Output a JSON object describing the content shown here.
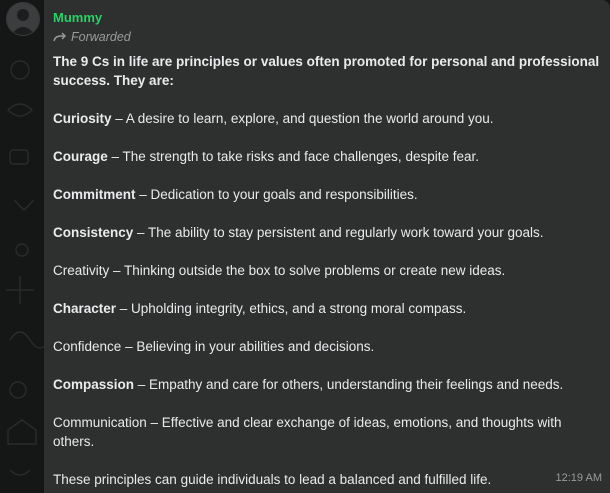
{
  "message": {
    "sender": "Mummy",
    "forwarded_label": "Forwarded",
    "intro": "The 9 Cs in life are principles or values often promoted for personal and professional success. They are:",
    "items": [
      {
        "term": "Curiosity",
        "desc": " – A desire to learn, explore, and question the world around you.",
        "bold": true
      },
      {
        "term": "Courage",
        "desc": " – The strength to take risks and face challenges, despite fear.",
        "bold": true
      },
      {
        "term": "Commitment",
        "desc": " – Dedication to your goals and responsibilities.",
        "bold": true
      },
      {
        "term": "Consistency",
        "desc": " – The ability to stay persistent and regularly work toward your goals.",
        "bold": true
      },
      {
        "term": "Creativity",
        "desc": " – Thinking outside the box to solve problems or create new ideas.",
        "bold": false
      },
      {
        "term": "Character",
        "desc": " – Upholding integrity, ethics, and a strong moral compass.",
        "bold": true
      },
      {
        "term": "Confidence",
        "desc": " – Believing in your abilities and decisions.",
        "bold": false
      },
      {
        "term": "Compassion",
        "desc": " – Empathy and care for others, understanding their feelings and needs.",
        "bold": true
      },
      {
        "term": "Communication",
        "desc": " – Effective and clear exchange of ideas, emotions, and thoughts with others.",
        "bold": false
      }
    ],
    "closing": "These principles can guide individuals to lead a balanced and fulfilled life.",
    "time": "12:19 AM"
  },
  "colors": {
    "sender": "#25d366",
    "bubble": "#2e2f2f",
    "background": "#151616",
    "text": "#e9ebec",
    "meta": "#9a9b9c"
  },
  "icons": {
    "forward": "forward-arrow-icon",
    "avatar": "avatar"
  }
}
